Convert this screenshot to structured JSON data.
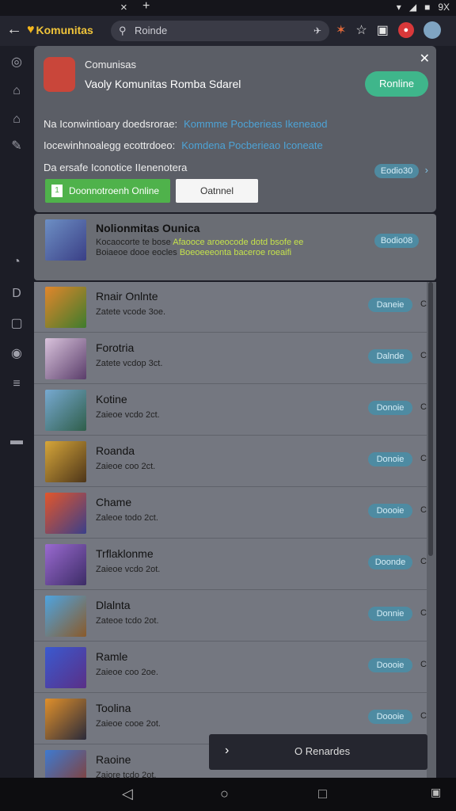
{
  "status": {
    "close_glyph": "×",
    "plus_glyph": "+",
    "battery_text": "9X"
  },
  "toolbar": {
    "app_name": "Komunitas",
    "url_text": "Roinde"
  },
  "panel": {
    "title": "Comunisas",
    "subtitle": "Vaoly Komunitas Romba Sdarel",
    "online_button": "Ronline",
    "line1_label": "Na Iconwintioary doedsrorae:",
    "line1_link": "Kommme Pocberieas Ikeneaod",
    "line2_label": "Iocewinhnoalegg ecottrdoeo:",
    "line2_link": "Komdena Pocberieao Iconeate",
    "line3_label": "Da ersafe Iconotice IIenenotera",
    "pill": "Eodio30",
    "green_button": "Doonnotroenh Online",
    "green_icon": "1",
    "white_button": "Oatnnel"
  },
  "featured": {
    "name": "Nolionmitas Ounica",
    "desc_line1": "Kocaocorte te bose",
    "desc_line1_green": "Afaooce aroeocode dotd bsofe ee",
    "desc_line2": "Boiaeoe dooe eocles",
    "desc_line2_green": "Boeoeeeonta baceroe roeaifi",
    "button": "Bodio08"
  },
  "rows": [
    {
      "name": "Rnair Onlnte",
      "sub": "Zatete vcode 3oe.",
      "button": "Daneie",
      "c": "C"
    },
    {
      "name": "Forotria",
      "sub": "Zatete vcdop 3ct.",
      "button": "Dalnde",
      "c": "C"
    },
    {
      "name": "Kotine",
      "sub": "Zaieoe vcdo 2ct.",
      "button": "Donoie",
      "c": "C"
    },
    {
      "name": "Roanda",
      "sub": "Zaieoe coo 2ct.",
      "button": "Donoie",
      "c": "C"
    },
    {
      "name": "Chame",
      "sub": "Zaleoe todo 2ct.",
      "button": "Doooie",
      "c": "C"
    },
    {
      "name": "Trflaklonme",
      "sub": "Zaieoe vcdo 2ot.",
      "button": "Doonde",
      "c": "C"
    },
    {
      "name": "Dlalnta",
      "sub": "Zateoe tcdo 2ot.",
      "button": "Donnie",
      "c": "C"
    },
    {
      "name": "Ramle",
      "sub": "Zaieoe coo 2oe.",
      "button": "Doooie",
      "c": "C"
    },
    {
      "name": "Toolina",
      "sub": "Zaieoe cooe 2ot.",
      "button": "Doooie",
      "c": "C"
    },
    {
      "name": "Raoine",
      "sub": "Zaiore tcdo 2ot.",
      "button": "",
      "c": ""
    }
  ],
  "toast": {
    "text": "O Renardes"
  },
  "colors": {
    "accent_green": "#3fb68b",
    "link_blue": "#4da3d6",
    "button_green": "#4fb24b"
  }
}
